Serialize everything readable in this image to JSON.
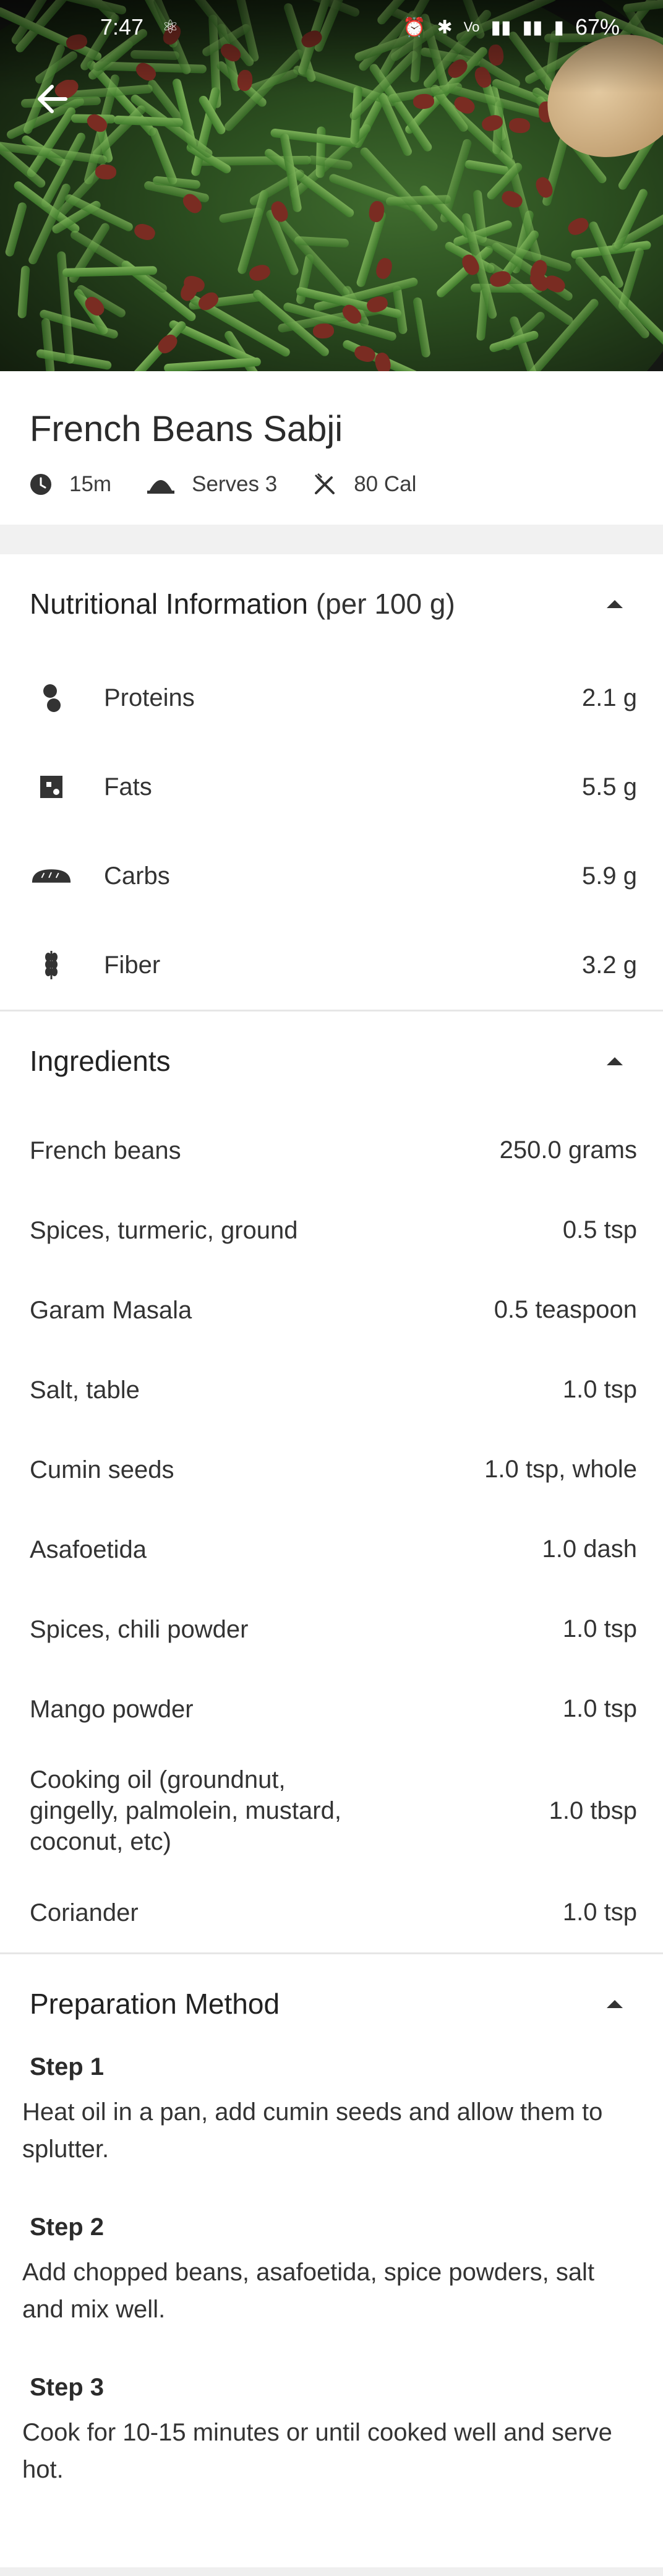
{
  "status_bar": {
    "time": "7:47",
    "battery": "67%"
  },
  "recipe": {
    "title": "French Beans Sabji",
    "time": "15m",
    "serves": "Serves 3",
    "calories": "80 Cal"
  },
  "nutrition": {
    "title": "Nutritional Information",
    "subtitle": "(per 100 g)",
    "items": [
      {
        "label": "Proteins",
        "value": "2.1 g",
        "icon": "bean-icon"
      },
      {
        "label": "Fats",
        "value": "5.5 g",
        "icon": "fat-icon"
      },
      {
        "label": "Carbs",
        "value": "5.9 g",
        "icon": "bread-icon"
      },
      {
        "label": "Fiber",
        "value": "3.2 g",
        "icon": "grain-icon"
      }
    ]
  },
  "ingredients": {
    "title": "Ingredients",
    "items": [
      {
        "name": "French beans",
        "qty": "250.0 grams"
      },
      {
        "name": "Spices, turmeric, ground",
        "qty": "0.5 tsp"
      },
      {
        "name": "Garam Masala",
        "qty": "0.5 teaspoon"
      },
      {
        "name": "Salt, table",
        "qty": "1.0 tsp"
      },
      {
        "name": "Cumin seeds",
        "qty": "1.0 tsp, whole"
      },
      {
        "name": "Asafoetida",
        "qty": "1.0 dash"
      },
      {
        "name": "Spices, chili powder",
        "qty": "1.0 tsp"
      },
      {
        "name": "Mango powder",
        "qty": "1.0 tsp"
      },
      {
        "name": "Cooking oil (groundnut, gingelly, palmolein, mustard, coconut, etc)",
        "qty": "1.0 tbsp"
      },
      {
        "name": "Coriander",
        "qty": "1.0 tsp"
      }
    ]
  },
  "method": {
    "title": "Preparation Method",
    "steps": [
      {
        "title": "Step 1",
        "text": "Heat oil in a pan, add cumin seeds and allow them to splutter."
      },
      {
        "title": "Step 2",
        "text": "Add chopped beans, asafoetida, spice powders, salt and mix well."
      },
      {
        "title": "Step 3",
        "text": "Cook for 10-15 minutes or until cooked well and serve hot."
      }
    ]
  }
}
